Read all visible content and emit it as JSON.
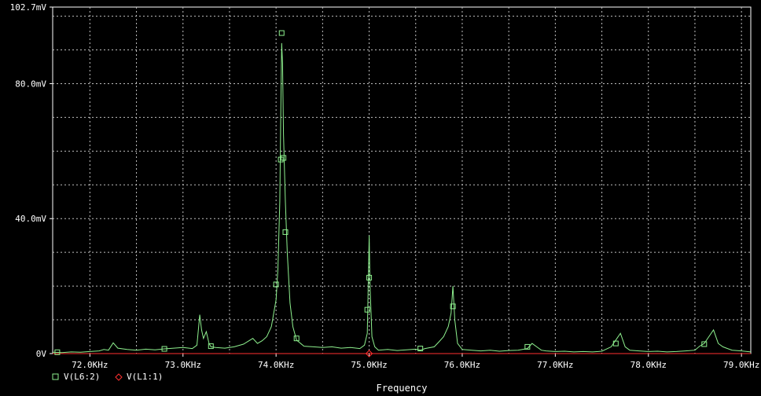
{
  "chart_data": {
    "type": "line",
    "title": "",
    "xlabel": "Frequency",
    "ylabel": "",
    "xlim": [
      71.6,
      79.1
    ],
    "ylim": [
      0,
      102.7
    ],
    "x_ticks": [
      {
        "value": 72.0,
        "label": "72.0KHz"
      },
      {
        "value": 73.0,
        "label": "73.0KHz"
      },
      {
        "value": 74.0,
        "label": "74.0KHz"
      },
      {
        "value": 75.0,
        "label": "75.0KHz"
      },
      {
        "value": 76.0,
        "label": "76.0KHz"
      },
      {
        "value": 77.0,
        "label": "77.0KHz"
      },
      {
        "value": 78.0,
        "label": "78.0KHz"
      },
      {
        "value": 79.0,
        "label": "79.0KHz"
      }
    ],
    "y_ticks": [
      {
        "value": 0,
        "label": "0V"
      },
      {
        "value": 40.0,
        "label": "40.0mV"
      },
      {
        "value": 80.0,
        "label": "80.0mV"
      },
      {
        "value": 102.7,
        "label": "102.7mV"
      }
    ],
    "grid": true,
    "legend_position": "bottom-left",
    "series": [
      {
        "name": "V(L6:2)",
        "color": "#8ef08e",
        "marker": "square",
        "points": [
          [
            71.6,
            0.4
          ],
          [
            71.7,
            0.3
          ],
          [
            71.8,
            0.5
          ],
          [
            71.9,
            0.4
          ],
          [
            72.0,
            0.6
          ],
          [
            72.1,
            0.8
          ],
          [
            72.15,
            1.2
          ],
          [
            72.2,
            1.0
          ],
          [
            72.25,
            3.2
          ],
          [
            72.3,
            1.6
          ],
          [
            72.4,
            1.2
          ],
          [
            72.5,
            1.0
          ],
          [
            72.6,
            1.3
          ],
          [
            72.7,
            1.1
          ],
          [
            72.8,
            1.4
          ],
          [
            72.9,
            1.6
          ],
          [
            73.0,
            1.8
          ],
          [
            73.1,
            1.5
          ],
          [
            73.15,
            2.5
          ],
          [
            73.18,
            11.5
          ],
          [
            73.2,
            7.0
          ],
          [
            73.22,
            4.5
          ],
          [
            73.25,
            6.5
          ],
          [
            73.28,
            3.0
          ],
          [
            73.3,
            2.0
          ],
          [
            73.35,
            1.8
          ],
          [
            73.45,
            1.6
          ],
          [
            73.55,
            2.0
          ],
          [
            73.65,
            2.8
          ],
          [
            73.75,
            4.5
          ],
          [
            73.8,
            3.0
          ],
          [
            73.85,
            3.8
          ],
          [
            73.9,
            5.0
          ],
          [
            73.95,
            8.0
          ],
          [
            74.0,
            16.0
          ],
          [
            74.02,
            25.0
          ],
          [
            74.04,
            45.0
          ],
          [
            74.05,
            70.0
          ],
          [
            74.06,
            92.0
          ],
          [
            74.07,
            86.0
          ],
          [
            74.08,
            65.0
          ],
          [
            74.1,
            45.0
          ],
          [
            74.12,
            30.0
          ],
          [
            74.15,
            15.0
          ],
          [
            74.18,
            8.0
          ],
          [
            74.22,
            4.0
          ],
          [
            74.3,
            2.2
          ],
          [
            74.4,
            2.0
          ],
          [
            74.5,
            1.8
          ],
          [
            74.6,
            2.0
          ],
          [
            74.7,
            1.6
          ],
          [
            74.8,
            1.8
          ],
          [
            74.9,
            1.5
          ],
          [
            74.95,
            2.5
          ],
          [
            74.98,
            6.0
          ],
          [
            75.0,
            35.0
          ],
          [
            75.01,
            20.0
          ],
          [
            75.03,
            5.0
          ],
          [
            75.06,
            2.0
          ],
          [
            75.1,
            1.0
          ],
          [
            75.2,
            1.2
          ],
          [
            75.3,
            0.9
          ],
          [
            75.4,
            1.1
          ],
          [
            75.5,
            1.3
          ],
          [
            75.55,
            1.0
          ],
          [
            75.6,
            1.5
          ],
          [
            75.7,
            2.0
          ],
          [
            75.75,
            3.5
          ],
          [
            75.8,
            5.0
          ],
          [
            75.85,
            8.0
          ],
          [
            75.88,
            12.0
          ],
          [
            75.9,
            20.0
          ],
          [
            75.92,
            10.0
          ],
          [
            75.95,
            3.0
          ],
          [
            76.0,
            1.2
          ],
          [
            76.1,
            1.0
          ],
          [
            76.2,
            0.8
          ],
          [
            76.3,
            1.0
          ],
          [
            76.4,
            0.7
          ],
          [
            76.5,
            0.9
          ],
          [
            76.6,
            1.0
          ],
          [
            76.7,
            1.5
          ],
          [
            76.75,
            3.0
          ],
          [
            76.8,
            2.0
          ],
          [
            76.85,
            1.0
          ],
          [
            76.9,
            0.8
          ],
          [
            77.0,
            0.6
          ],
          [
            77.1,
            0.7
          ],
          [
            77.2,
            0.5
          ],
          [
            77.3,
            0.6
          ],
          [
            77.4,
            0.5
          ],
          [
            77.5,
            0.7
          ],
          [
            77.6,
            2.0
          ],
          [
            77.65,
            4.0
          ],
          [
            77.7,
            6.0
          ],
          [
            77.75,
            2.0
          ],
          [
            77.8,
            1.0
          ],
          [
            77.9,
            0.8
          ],
          [
            78.0,
            0.6
          ],
          [
            78.1,
            0.7
          ],
          [
            78.2,
            0.5
          ],
          [
            78.3,
            0.6
          ],
          [
            78.4,
            0.8
          ],
          [
            78.5,
            1.0
          ],
          [
            78.55,
            2.2
          ],
          [
            78.6,
            3.0
          ],
          [
            78.65,
            5.0
          ],
          [
            78.7,
            7.0
          ],
          [
            78.75,
            3.0
          ],
          [
            78.8,
            2.0
          ],
          [
            78.85,
            1.5
          ],
          [
            78.9,
            1.0
          ],
          [
            79.0,
            0.8
          ],
          [
            79.1,
            0.5
          ]
        ],
        "marker_points": [
          [
            71.65,
            0.4
          ],
          [
            72.8,
            1.4
          ],
          [
            73.3,
            2.2
          ],
          [
            74.0,
            20.5
          ],
          [
            74.05,
            57.5
          ],
          [
            74.06,
            95.0
          ],
          [
            74.08,
            58.0
          ],
          [
            74.1,
            36.0
          ],
          [
            74.22,
            4.5
          ],
          [
            74.98,
            13.0
          ],
          [
            75.0,
            22.5
          ],
          [
            75.55,
            1.5
          ],
          [
            75.9,
            14.0
          ],
          [
            76.7,
            2.0
          ],
          [
            77.65,
            3.0
          ],
          [
            78.6,
            2.8
          ]
        ]
      },
      {
        "name": "V(L1:1)",
        "color": "#ff3030",
        "marker": "diamond",
        "points": [
          [
            71.6,
            0
          ],
          [
            79.1,
            0
          ]
        ],
        "marker_points": [
          [
            75.0,
            0
          ]
        ]
      }
    ]
  }
}
